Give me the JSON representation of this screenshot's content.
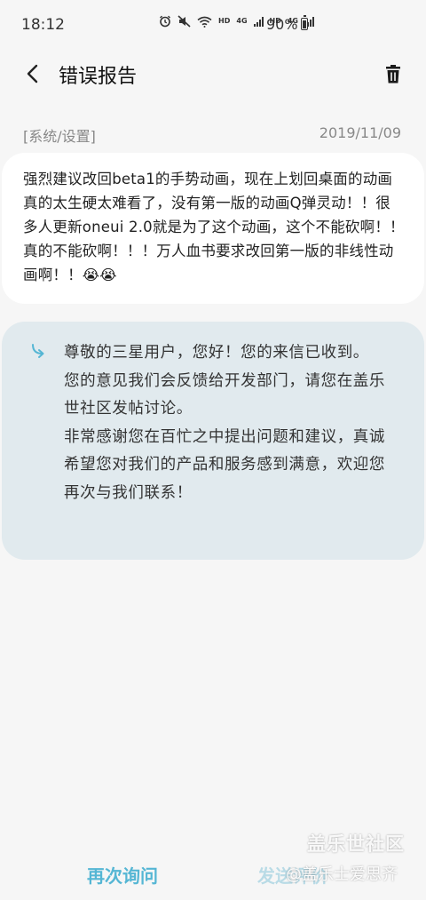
{
  "status_bar": {
    "time": "18:12",
    "battery": "90%",
    "hd_label": "HD",
    "network_label": "4G",
    "icons": [
      "alarm-icon",
      "mute-icon",
      "wifi-icon",
      "signal-icon",
      "signal-icon"
    ]
  },
  "header": {
    "title": "错误报告",
    "back_icon": "chevron-left-icon",
    "delete_icon": "trash-icon"
  },
  "report": {
    "category": "[系统/设置]",
    "date": "2019/11/09",
    "text": "强烈建议改回beta1的手势动画，现在上划回桌面的动画真的太生硬太难看了，没有第一版的动画Q弹灵动！！很多人更新oneui 2.0就是为了这个动画，这个不能砍啊！！真的不能砍啊！！！万人血书要求改回第一版的非线性动画啊！！😭😭"
  },
  "reply": {
    "icon": "reply-arrow-icon",
    "paragraphs": [
      "尊敬的三星用户，您好！您的来信已收到。",
      "您的意见我们会反馈给开发部门，请您在盖乐世社区发帖讨论。",
      "非常感谢您在百忙之中提出问题和建议，真诚希望您对我们的产品和服务感到满意，欢迎您再次与我们联系！"
    ]
  },
  "actions": {
    "ask_again": "再次询问",
    "send_rating": "发送评价"
  },
  "watermark": {
    "line1": "盖乐世社区",
    "line2": "@盖乐士爱思齐"
  },
  "colors": {
    "accent": "#55b6d4",
    "reply_bg": "#e1eaee",
    "page_bg": "#f6f6f6"
  }
}
